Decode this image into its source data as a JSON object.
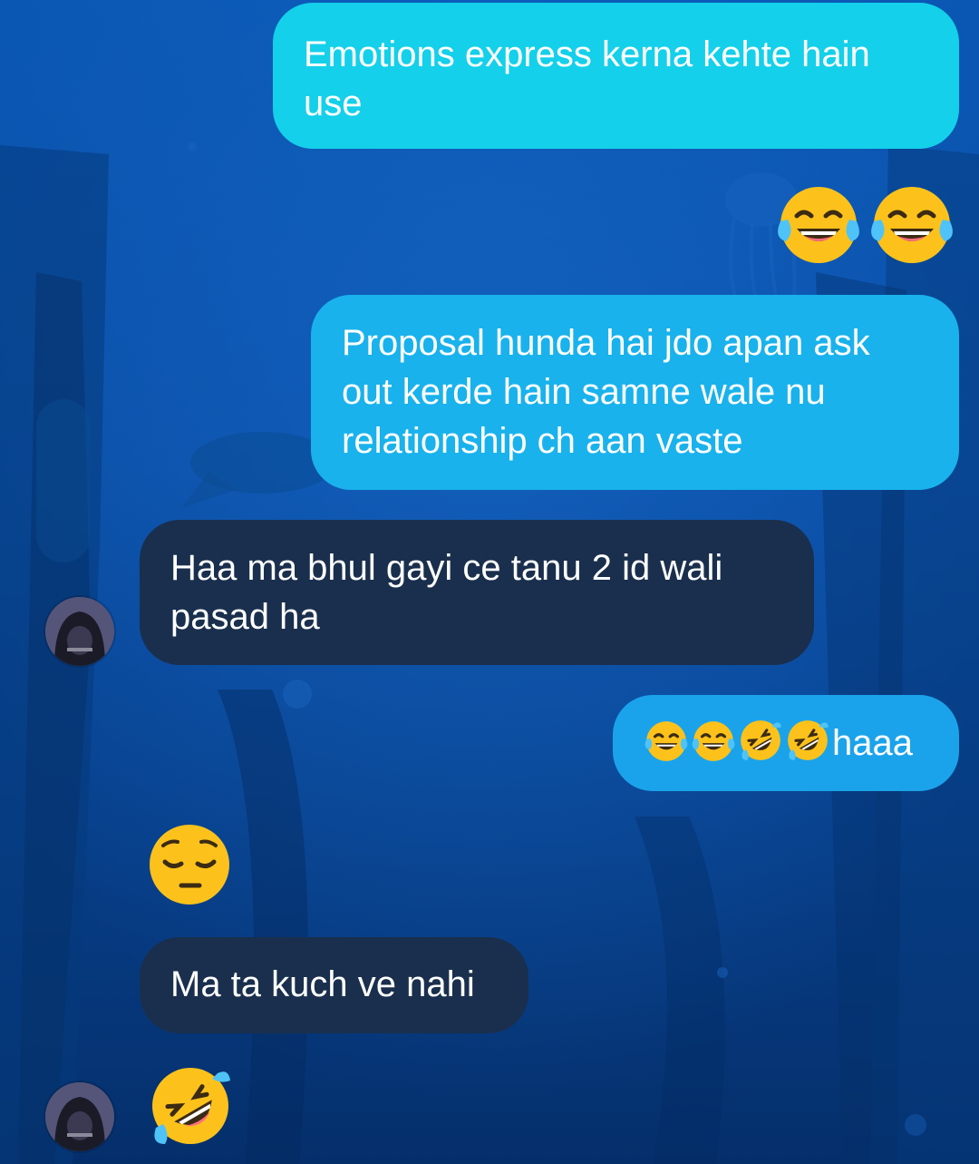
{
  "chat": {
    "messages": [
      {
        "side": "sent",
        "text": "Emotions express kerna kehte hain use"
      },
      {
        "side": "sent",
        "emoji": [
          "face-with-tears-of-joy",
          "face-with-tears-of-joy"
        ]
      },
      {
        "side": "sent",
        "text": "Proposal hunda hai jdo apan ask out kerde hain samne wale nu relationship ch aan vaste"
      },
      {
        "side": "received",
        "text": "Haa ma bhul gayi ce tanu 2 id wali pasad ha"
      },
      {
        "side": "sent",
        "emoji": [
          "face-with-tears-of-joy",
          "face-with-tears-of-joy",
          "rolling-on-the-floor-laughing",
          "rolling-on-the-floor-laughing"
        ],
        "text": "haaa"
      },
      {
        "side": "received",
        "emoji": [
          "pensive-face"
        ]
      },
      {
        "side": "received",
        "text": "Ma ta kuch ve nahi"
      },
      {
        "side": "received",
        "emoji": [
          "rolling-on-the-floor-laughing"
        ]
      }
    ]
  },
  "colors": {
    "sent_bubble": "#19b4ea",
    "received_bubble": "#1a2f4d",
    "background": "#0a4ea6",
    "text": "#ffffff"
  },
  "icons": {
    "avatar": "contact-avatar"
  }
}
